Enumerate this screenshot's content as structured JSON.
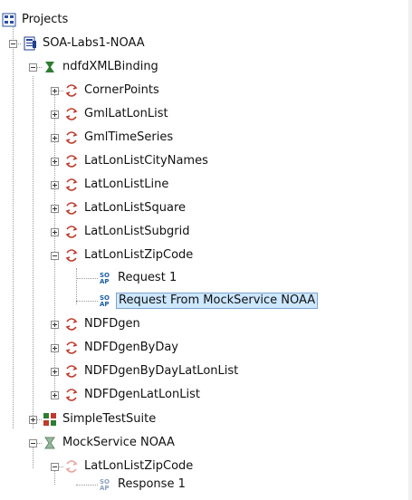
{
  "tree": {
    "root": {
      "label": "Projects"
    },
    "project": {
      "label": "SOA-Labs1-NOAA"
    },
    "binding": {
      "label": "ndfdXMLBinding"
    },
    "operations": [
      {
        "label": "CornerPoints"
      },
      {
        "label": "GmlLatLonList"
      },
      {
        "label": "GmlTimeSeries"
      },
      {
        "label": "LatLonListCityNames"
      },
      {
        "label": "LatLonListLine"
      },
      {
        "label": "LatLonListSquare"
      },
      {
        "label": "LatLonListSubgrid"
      },
      {
        "label": "LatLonListZipCode"
      }
    ],
    "requests": [
      {
        "label": "Request 1"
      },
      {
        "label": "Request From MockService NOAA"
      }
    ],
    "operations_after": [
      {
        "label": "NDFDgen"
      },
      {
        "label": "NDFDgenByDay"
      },
      {
        "label": "NDFDgenByDayLatLonList"
      },
      {
        "label": "NDFDgenLatLonList"
      }
    ],
    "test_suite": {
      "label": "SimpleTestSuite"
    },
    "mock_service": {
      "label": "MockService NOAA"
    },
    "mock_operation": {
      "label": "LatLonListZipCode"
    },
    "mock_response": {
      "label": "Response 1"
    }
  },
  "colors": {
    "selection_bg": "#cde8ff",
    "operation_icon": "#c0392b",
    "binding_icon": "#2e7d32",
    "project_icon": "#1f3f8f"
  }
}
